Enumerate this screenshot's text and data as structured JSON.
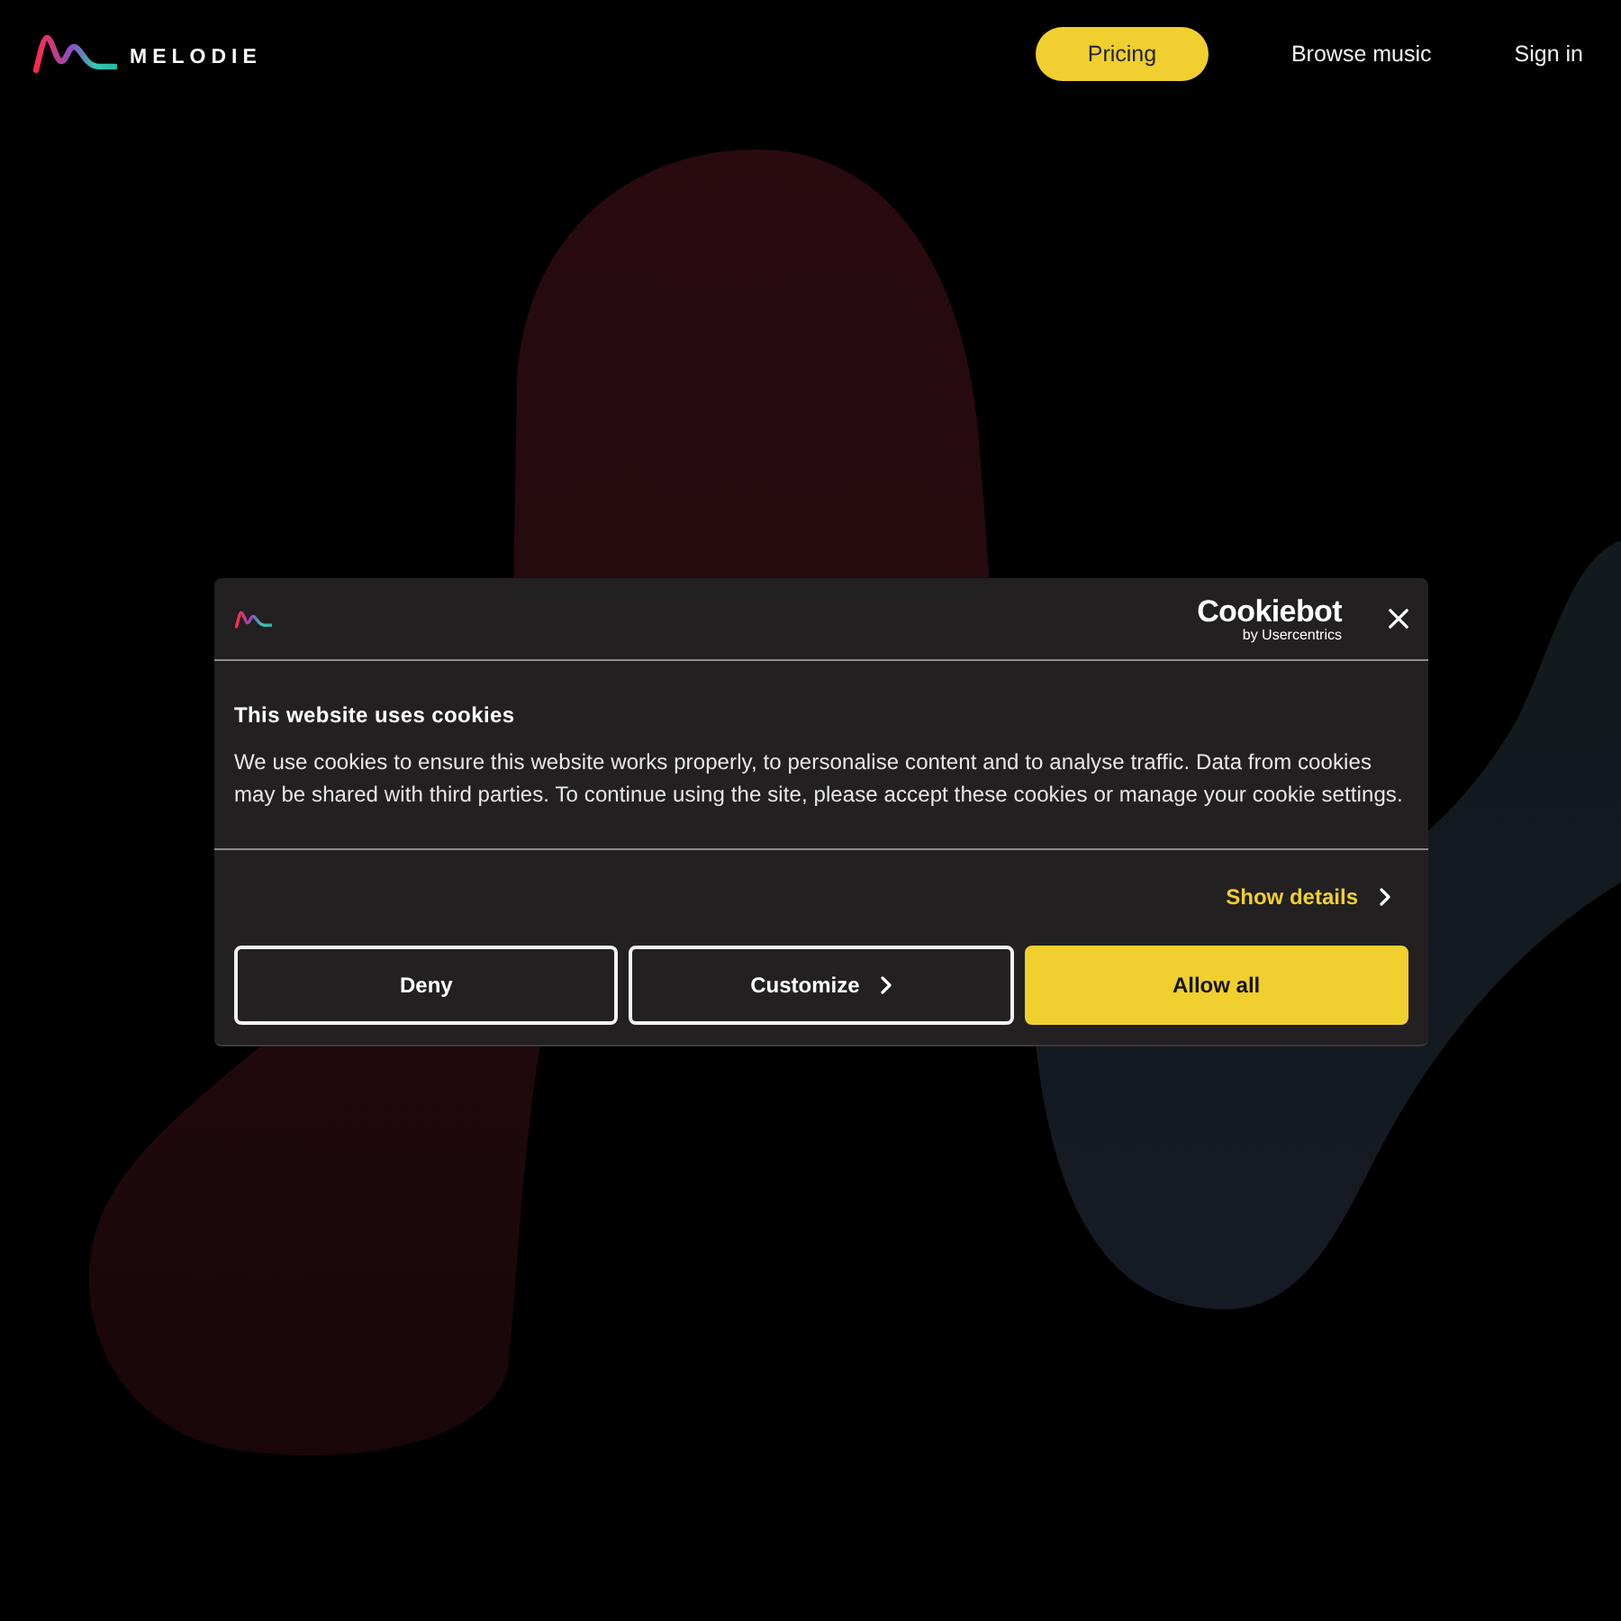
{
  "header": {
    "logo_text": "MELODIE",
    "nav": [
      {
        "label": "Pricing",
        "kind": "pill"
      },
      {
        "label": "Browse music",
        "kind": "link"
      },
      {
        "label": "Sign in",
        "kind": "link"
      }
    ]
  },
  "cookie_dialog": {
    "brand": {
      "name": "Cookiebot",
      "tagline": "by Usercentrics"
    },
    "title": "This website uses cookies",
    "body": "We use cookies to ensure this website works properly, to personalise content and to analyse traffic. Data from cookies may be shared with third parties. To continue using the site, please accept these cookies or manage your cookie settings.",
    "show_details": "Show details",
    "buttons": [
      {
        "label": "Deny",
        "kind": "outline",
        "chevron": false
      },
      {
        "label": "Customize",
        "kind": "outline",
        "chevron": true
      },
      {
        "label": "Allow all",
        "kind": "filled",
        "chevron": false
      }
    ]
  }
}
